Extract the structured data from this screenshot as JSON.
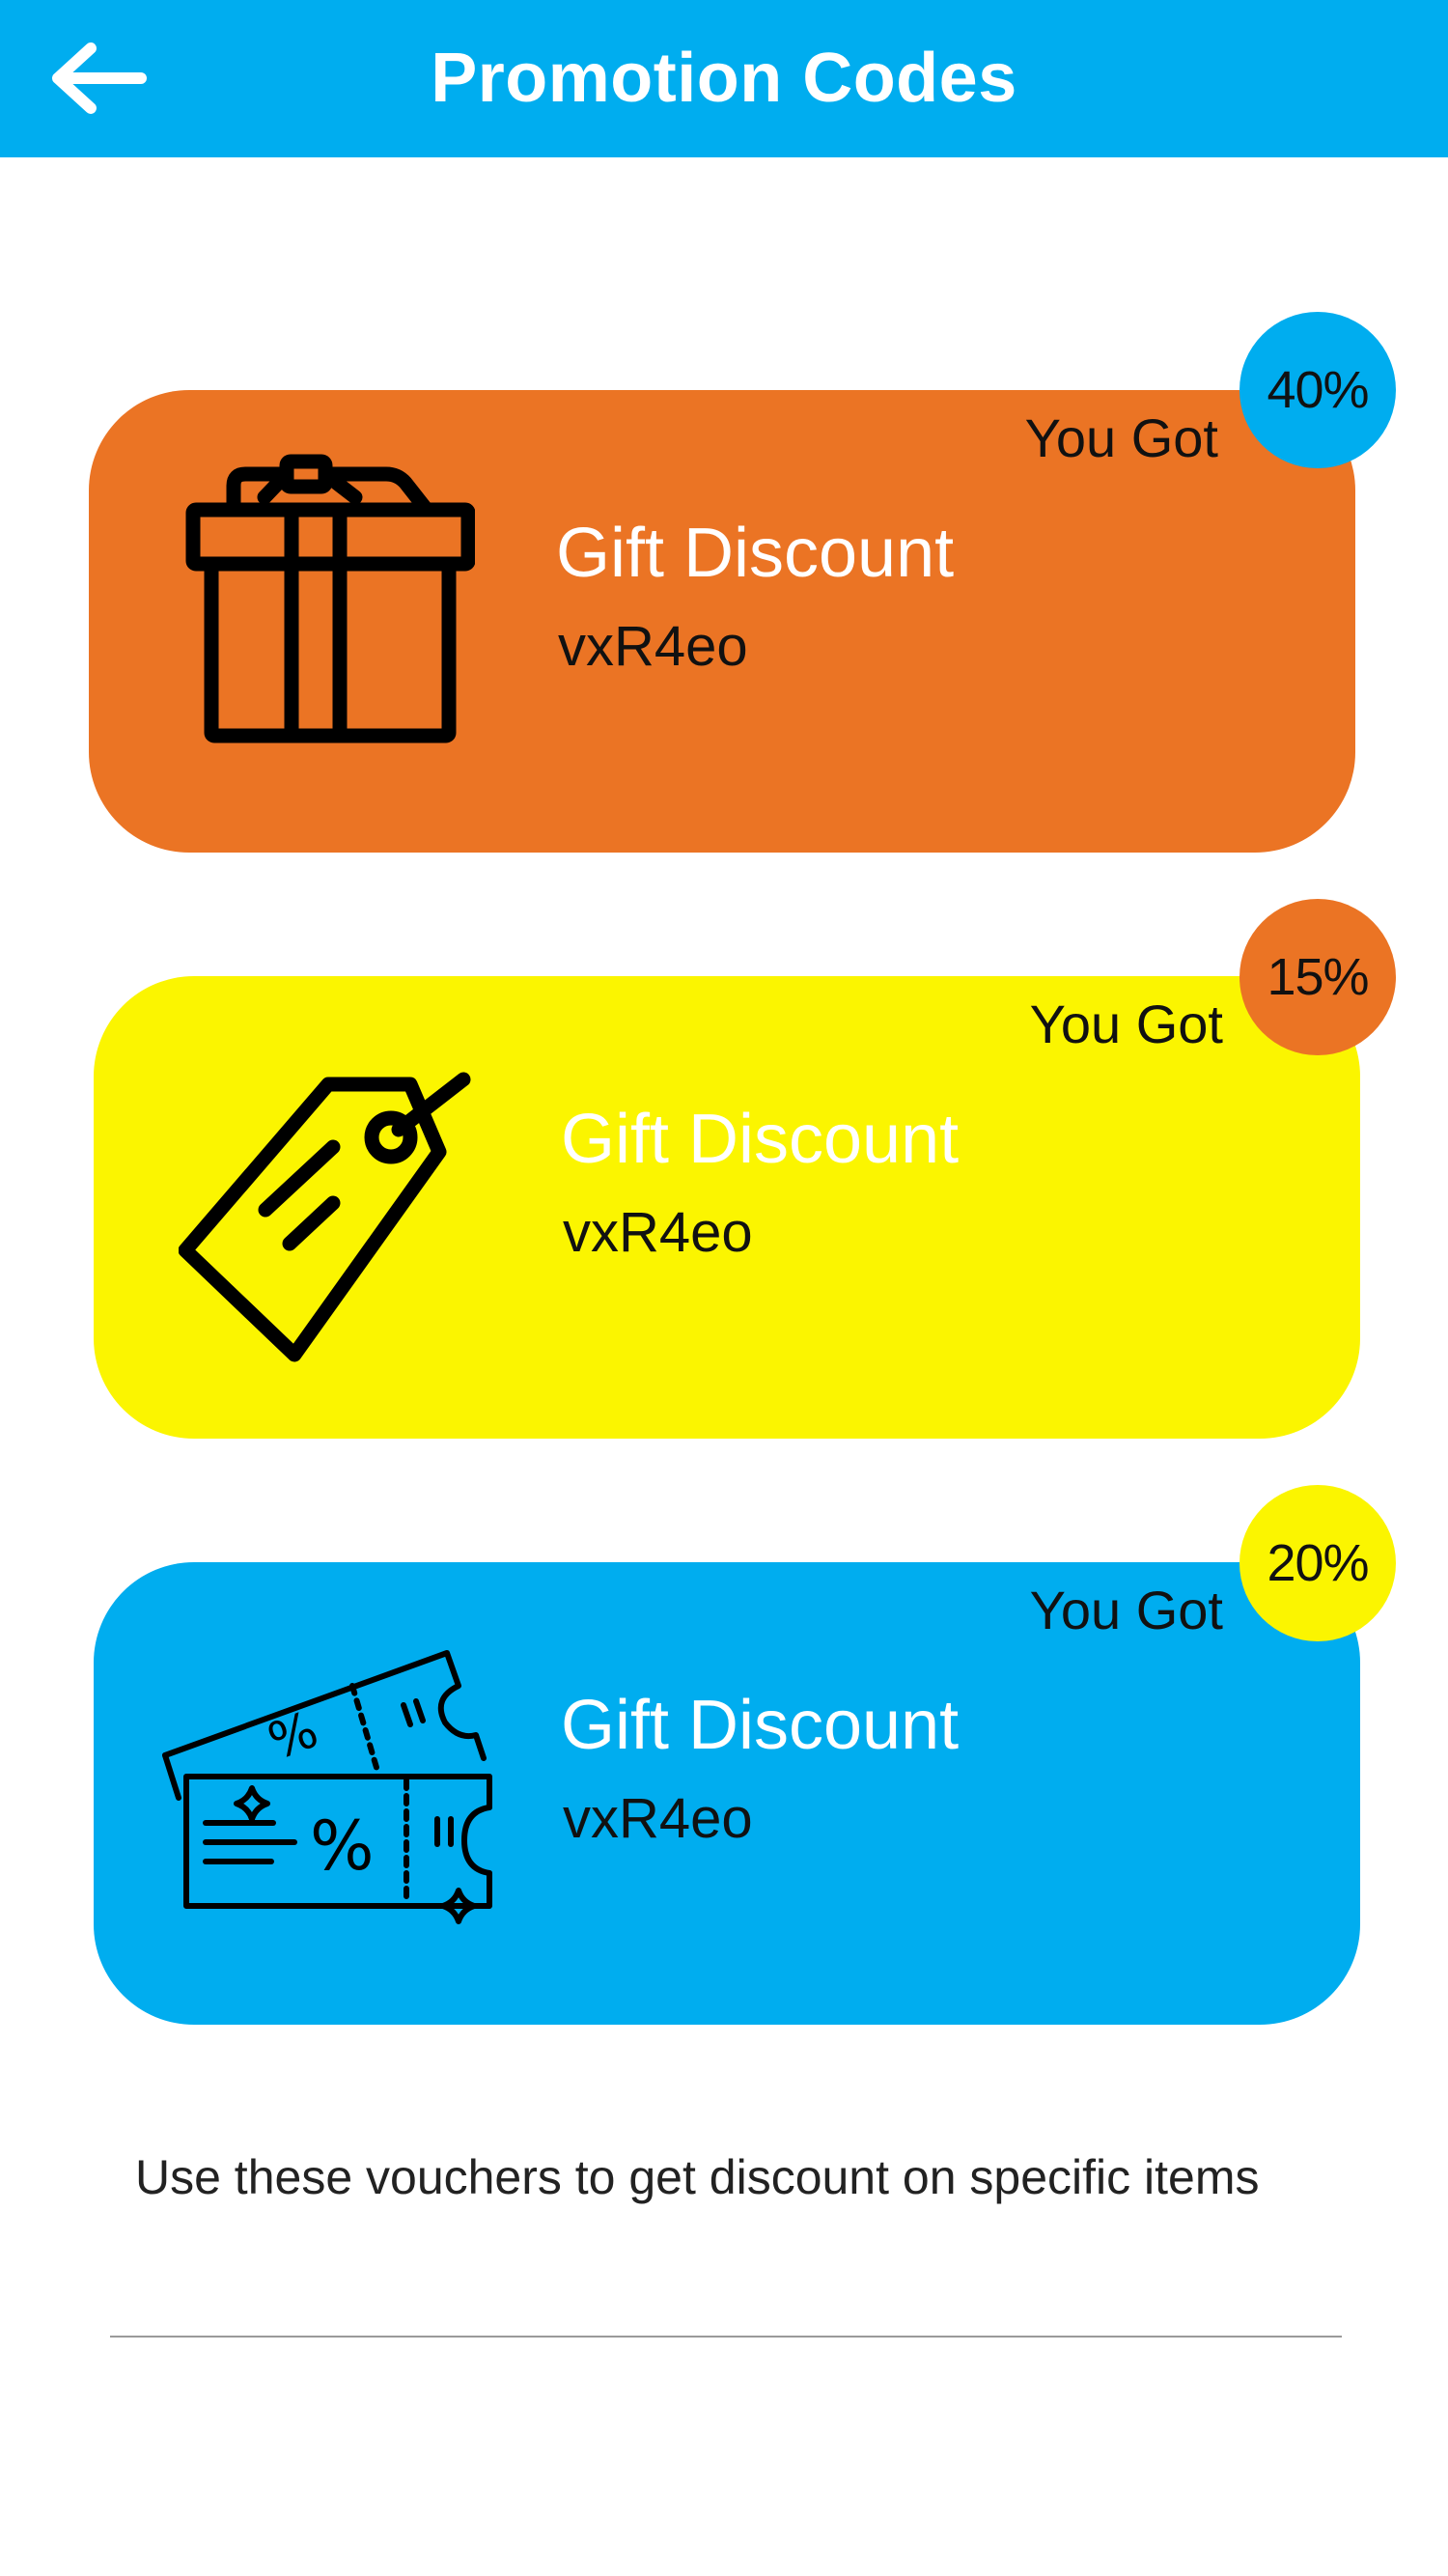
{
  "header": {
    "title": "Promotion Codes",
    "background": "#00adef",
    "back_icon": "arrow-left-icon"
  },
  "vouchers": [
    {
      "label": "You Got",
      "percent": "40%",
      "title": "Gift Discount",
      "code": "vxR4eo",
      "card_color": "#eb7424",
      "badge_color": "#00adef",
      "icon": "gift-box-icon"
    },
    {
      "label": "You Got",
      "percent": "15%",
      "title": "Gift Discount",
      "code": "vxR4eo",
      "card_color": "#fbf500",
      "badge_color": "#eb7424",
      "icon": "price-tag-icon"
    },
    {
      "label": "You Got",
      "percent": "20%",
      "title": "Gift Discount",
      "code": "vxR4eo",
      "card_color": "#00adef",
      "badge_color": "#fbf500",
      "icon": "discount-tickets-icon"
    }
  ],
  "info_text": "Use these vouchers to get discount on specific items"
}
